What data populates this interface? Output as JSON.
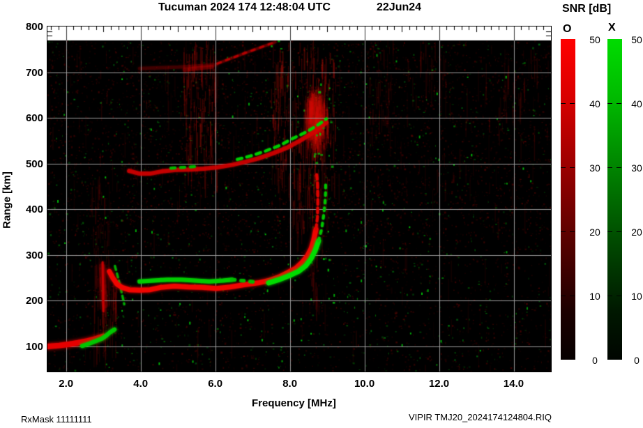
{
  "title": {
    "main": "Tucuman 2024 174 12:48:04 UTC",
    "date": "22Jun24"
  },
  "axes": {
    "y_label": "Range [km]",
    "x_label": "Frequency [MHz]",
    "y_ticks": [
      800,
      700,
      600,
      500,
      400,
      300,
      200,
      100
    ],
    "x_ticks": [
      "2.0",
      "4.0",
      "6.0",
      "8.0",
      "10.0",
      "12.0",
      "14.0"
    ],
    "freq_range": [
      1.5,
      15.0
    ],
    "range_km": [
      45,
      800
    ],
    "grid_freq_step": 2.0,
    "grid_range_step": 100,
    "minor_tick_freq_step": 0.2,
    "minor_tick_range_step": 10
  },
  "colorbar": {
    "title": "SNR [dB]",
    "o_label": "O",
    "x_label": "X",
    "ticks": [
      50,
      40,
      30,
      20,
      10,
      0
    ],
    "min": 0,
    "max": 50,
    "o_color_top": "#ff0000",
    "x_color_top": "#00dc00"
  },
  "footer": {
    "left": "RxMask 11111111",
    "right": "VIPIR  TMJ20_2024174124804.RIQ"
  },
  "chart_data": {
    "type": "heatmap",
    "title": "Tucuman 2024 174 12:48:04 UTC 22Jun24",
    "xlabel": "Frequency [MHz]",
    "ylabel": "Range [km]",
    "xlim": [
      1.5,
      15.0
    ],
    "ylim": [
      45,
      800
    ],
    "data_top_km": 780,
    "background": "#000000",
    "grid_color": "#a8a8a8",
    "o_mode_color": "#f00500",
    "x_mode_color": "#00cc00",
    "noise_seed": 42,
    "traces": [
      {
        "name": "E-layer-O",
        "mode": "O",
        "layer": "front",
        "color": "#e60000",
        "width": 8,
        "alpha": 1,
        "glow": 5,
        "dash": null,
        "points": [
          [
            1.5,
            100
          ],
          [
            1.82,
            102
          ],
          [
            2.1,
            105
          ],
          [
            2.32,
            108
          ],
          [
            2.57,
            112
          ],
          [
            2.81,
            117
          ],
          [
            3.0,
            122
          ]
        ]
      },
      {
        "name": "E-layer-X",
        "mode": "X",
        "layer": "front",
        "color": "#00c800",
        "width": 6,
        "alpha": 0.95,
        "glow": 4,
        "dash": null,
        "points": [
          [
            2.43,
            101
          ],
          [
            2.62,
            106
          ],
          [
            2.81,
            112
          ],
          [
            2.96,
            117
          ],
          [
            3.07,
            123
          ],
          [
            3.18,
            131
          ],
          [
            3.3,
            137
          ]
        ]
      },
      {
        "name": "E-cusp-smear",
        "mode": "O",
        "layer": "back",
        "color": "#bb0000",
        "width": 9,
        "alpha": 0.3,
        "glow": 8,
        "dash": null,
        "points": [
          [
            2.96,
            275
          ],
          [
            2.99,
            235
          ],
          [
            3.04,
            190
          ]
        ]
      },
      {
        "name": "E-cusp",
        "mode": "O",
        "layer": "front",
        "color": "#cc0000",
        "width": 3,
        "alpha": 0.85,
        "glow": 3,
        "dash": null,
        "points": [
          [
            2.98,
            284
          ],
          [
            2.99,
            230
          ],
          [
            3.0,
            177
          ]
        ]
      },
      {
        "name": "cusp-X-diagonal",
        "mode": "X",
        "layer": "front",
        "color": "#00b400",
        "width": 3,
        "alpha": 0.85,
        "glow": 2,
        "dash": [
          6,
          5
        ],
        "points": [
          [
            3.31,
            276
          ],
          [
            3.45,
            233
          ],
          [
            3.56,
            192
          ]
        ]
      },
      {
        "name": "F-trace-O",
        "mode": "O",
        "layer": "front",
        "color": "#f00500",
        "width": 7,
        "alpha": 1,
        "glow": 4,
        "dash": null,
        "points": [
          [
            3.16,
            264
          ],
          [
            3.26,
            249
          ],
          [
            3.37,
            236
          ],
          [
            3.5,
            229
          ],
          [
            3.69,
            224
          ],
          [
            3.97,
            223
          ],
          [
            4.25,
            224
          ],
          [
            4.53,
            229
          ],
          [
            4.9,
            232
          ],
          [
            5.28,
            230
          ],
          [
            5.65,
            229
          ],
          [
            6.03,
            227
          ],
          [
            6.4,
            230
          ],
          [
            6.77,
            235
          ],
          [
            7.15,
            239
          ],
          [
            7.43,
            244
          ],
          [
            7.71,
            252
          ],
          [
            7.93,
            261
          ],
          [
            8.16,
            271
          ],
          [
            8.33,
            284
          ],
          [
            8.46,
            297
          ],
          [
            8.57,
            314
          ],
          [
            8.64,
            333
          ],
          [
            8.7,
            356
          ]
        ]
      },
      {
        "name": "F-trace-O-asymptote",
        "mode": "O",
        "layer": "front",
        "color": "#e00400",
        "width": 4,
        "alpha": 0.9,
        "glow": 2,
        "dash": [
          7,
          5
        ],
        "points": [
          [
            8.7,
            356
          ],
          [
            8.74,
            383
          ],
          [
            8.75,
            409
          ],
          [
            8.75,
            435
          ],
          [
            8.74,
            460
          ],
          [
            8.72,
            476
          ]
        ]
      },
      {
        "name": "F-trace-X-flat",
        "mode": "X",
        "layer": "front",
        "color": "#00cc00",
        "width": 6,
        "alpha": 0.95,
        "glow": 3,
        "dash": null,
        "points": [
          [
            3.97,
            242
          ],
          [
            4.34,
            244
          ],
          [
            4.72,
            246
          ],
          [
            5.09,
            246
          ],
          [
            5.46,
            244
          ],
          [
            5.84,
            242
          ],
          [
            6.21,
            244
          ],
          [
            6.45,
            246
          ]
        ]
      },
      {
        "name": "F-trace-X-sparse",
        "mode": "X",
        "layer": "front",
        "color": "#00bb00",
        "width": 5,
        "alpha": 0.85,
        "glow": 2,
        "dash": [
          4,
          9
        ],
        "points": [
          [
            6.45,
            246
          ],
          [
            6.85,
            243
          ],
          [
            7.15,
            240
          ]
        ]
      },
      {
        "name": "F-trace-X-rise",
        "mode": "X",
        "layer": "front",
        "color": "#00dc00",
        "width": 7,
        "alpha": 1,
        "glow": 4,
        "dash": null,
        "points": [
          [
            7.43,
            239
          ],
          [
            7.71,
            246
          ],
          [
            7.99,
            255
          ],
          [
            8.23,
            264
          ],
          [
            8.42,
            276
          ],
          [
            8.57,
            292
          ],
          [
            8.68,
            310
          ],
          [
            8.77,
            331
          ]
        ]
      },
      {
        "name": "F-trace-X-asymptote",
        "mode": "X",
        "layer": "front",
        "color": "#00c800",
        "width": 4,
        "alpha": 0.9,
        "glow": 2,
        "dash": [
          4,
          7
        ],
        "points": [
          [
            8.77,
            331
          ],
          [
            8.85,
            356
          ],
          [
            8.9,
            383
          ],
          [
            8.94,
            411
          ],
          [
            8.96,
            438
          ],
          [
            8.96,
            463
          ]
        ]
      },
      {
        "name": "second-hop-O",
        "mode": "O",
        "layer": "front",
        "color": "#d40000",
        "width": 6,
        "alpha": 0.75,
        "glow": 3,
        "dash": null,
        "points": [
          [
            3.69,
            484
          ],
          [
            3.97,
            478
          ],
          [
            4.25,
            478
          ],
          [
            4.57,
            483
          ],
          [
            4.94,
            486
          ],
          [
            5.31,
            487
          ],
          [
            5.69,
            489
          ],
          [
            6.06,
            492
          ],
          [
            6.44,
            497
          ],
          [
            6.81,
            504
          ],
          [
            7.18,
            512
          ],
          [
            7.56,
            523
          ],
          [
            7.93,
            535
          ],
          [
            8.27,
            550
          ],
          [
            8.55,
            564
          ],
          [
            8.79,
            578
          ],
          [
            8.98,
            590
          ]
        ]
      },
      {
        "name": "second-hop-X-left",
        "mode": "X",
        "layer": "front",
        "color": "#00bb00",
        "width": 4,
        "alpha": 0.9,
        "glow": 2,
        "dash": [
          6,
          8
        ],
        "points": [
          [
            4.81,
            490
          ],
          [
            5.18,
            492
          ],
          [
            5.56,
            494
          ]
        ]
      },
      {
        "name": "second-hop-X",
        "mode": "X",
        "layer": "front",
        "color": "#00cc00",
        "width": 4,
        "alpha": 0.95,
        "glow": 2,
        "dash": [
          7,
          7
        ],
        "points": [
          [
            6.59,
            509
          ],
          [
            6.96,
            517
          ],
          [
            7.33,
            527
          ],
          [
            7.71,
            539
          ],
          [
            8.08,
            555
          ],
          [
            8.46,
            570
          ],
          [
            8.74,
            584
          ],
          [
            8.98,
            598
          ]
        ]
      },
      {
        "name": "700km-band",
        "mode": "O",
        "layer": "back",
        "color": "#cc0000",
        "width": 5,
        "alpha": 0.2,
        "glow": 4,
        "dash": null,
        "points": [
          [
            3.97,
            708
          ],
          [
            5.0,
            711
          ],
          [
            6.02,
            716
          ]
        ]
      },
      {
        "name": "700km-band-bright",
        "mode": "O",
        "layer": "back",
        "color": "#cc0000",
        "width": 6,
        "alpha": 0.28,
        "glow": 4,
        "dash": null,
        "points": [
          [
            5.18,
            705
          ],
          [
            5.9,
            712
          ]
        ]
      },
      {
        "name": "upper-diagonal",
        "mode": "O",
        "layer": "back",
        "color": "#cc0000",
        "width": 4,
        "alpha": 0.3,
        "glow": 3,
        "dash": null,
        "points": [
          [
            6.06,
            719
          ],
          [
            6.8,
            742
          ],
          [
            7.61,
            766
          ]
        ]
      },
      {
        "name": "upper-diagonal-dashes",
        "mode": "O",
        "layer": "back",
        "color": "#d40000",
        "width": 3,
        "alpha": 0.5,
        "glow": 2,
        "dash": [
          5,
          8
        ],
        "points": [
          [
            6.06,
            719
          ],
          [
            6.8,
            742
          ],
          [
            7.61,
            766
          ]
        ]
      }
    ],
    "striation_bands": [
      {
        "f": [
          2.75,
          3.4
        ],
        "km": [
          100,
          285
        ],
        "n": 90,
        "a": 0.5
      },
      {
        "f": [
          2.6,
          3.2
        ],
        "km": [
          285,
          480
        ],
        "n": 40,
        "a": 0.35
      },
      {
        "f": [
          5.15,
          6.05
        ],
        "km": [
          480,
          770
        ],
        "n": 140,
        "a": 0.8
      },
      {
        "f": [
          7.5,
          9.25
        ],
        "km": [
          470,
          770
        ],
        "n": 200,
        "a": 0.9
      },
      {
        "f": [
          8.05,
          9.0
        ],
        "km": [
          350,
          480
        ],
        "n": 60,
        "a": 0.5
      },
      {
        "f": [
          8.55,
          8.78
        ],
        "km": [
          190,
          350
        ],
        "n": 25,
        "a": 0.4
      },
      {
        "f": [
          10.2,
          10.8
        ],
        "km": [
          600,
          770
        ],
        "n": 30,
        "a": 0.35
      },
      {
        "f": [
          11.5,
          12.2
        ],
        "km": [
          620,
          770
        ],
        "n": 25,
        "a": 0.3
      },
      {
        "f": [
          13.2,
          14.7
        ],
        "km": [
          560,
          770
        ],
        "n": 45,
        "a": 0.35
      },
      {
        "f": [
          1.5,
          15.0
        ],
        "km": [
          450,
          770
        ],
        "n": 150,
        "a": 0.22
      },
      {
        "f": [
          1.5,
          15.0
        ],
        "km": [
          45,
          450
        ],
        "n": 80,
        "a": 0.15
      }
    ],
    "diffuse_blob": {
      "f": [
        8.15,
        9.3
      ],
      "km": [
        480,
        700
      ],
      "center_f": 8.7,
      "center_km": 600,
      "n": 260
    },
    "green_speck_regions": [
      {
        "f": [
          8.85,
          9.15
        ],
        "km": [
          190,
          300
        ],
        "n": 6
      },
      {
        "f": [
          8.6,
          9.15
        ],
        "km": [
          480,
          680
        ],
        "n": 14
      },
      {
        "f": [
          7.4,
          7.75
        ],
        "km": [
          745,
          770
        ],
        "n": 3
      }
    ]
  }
}
